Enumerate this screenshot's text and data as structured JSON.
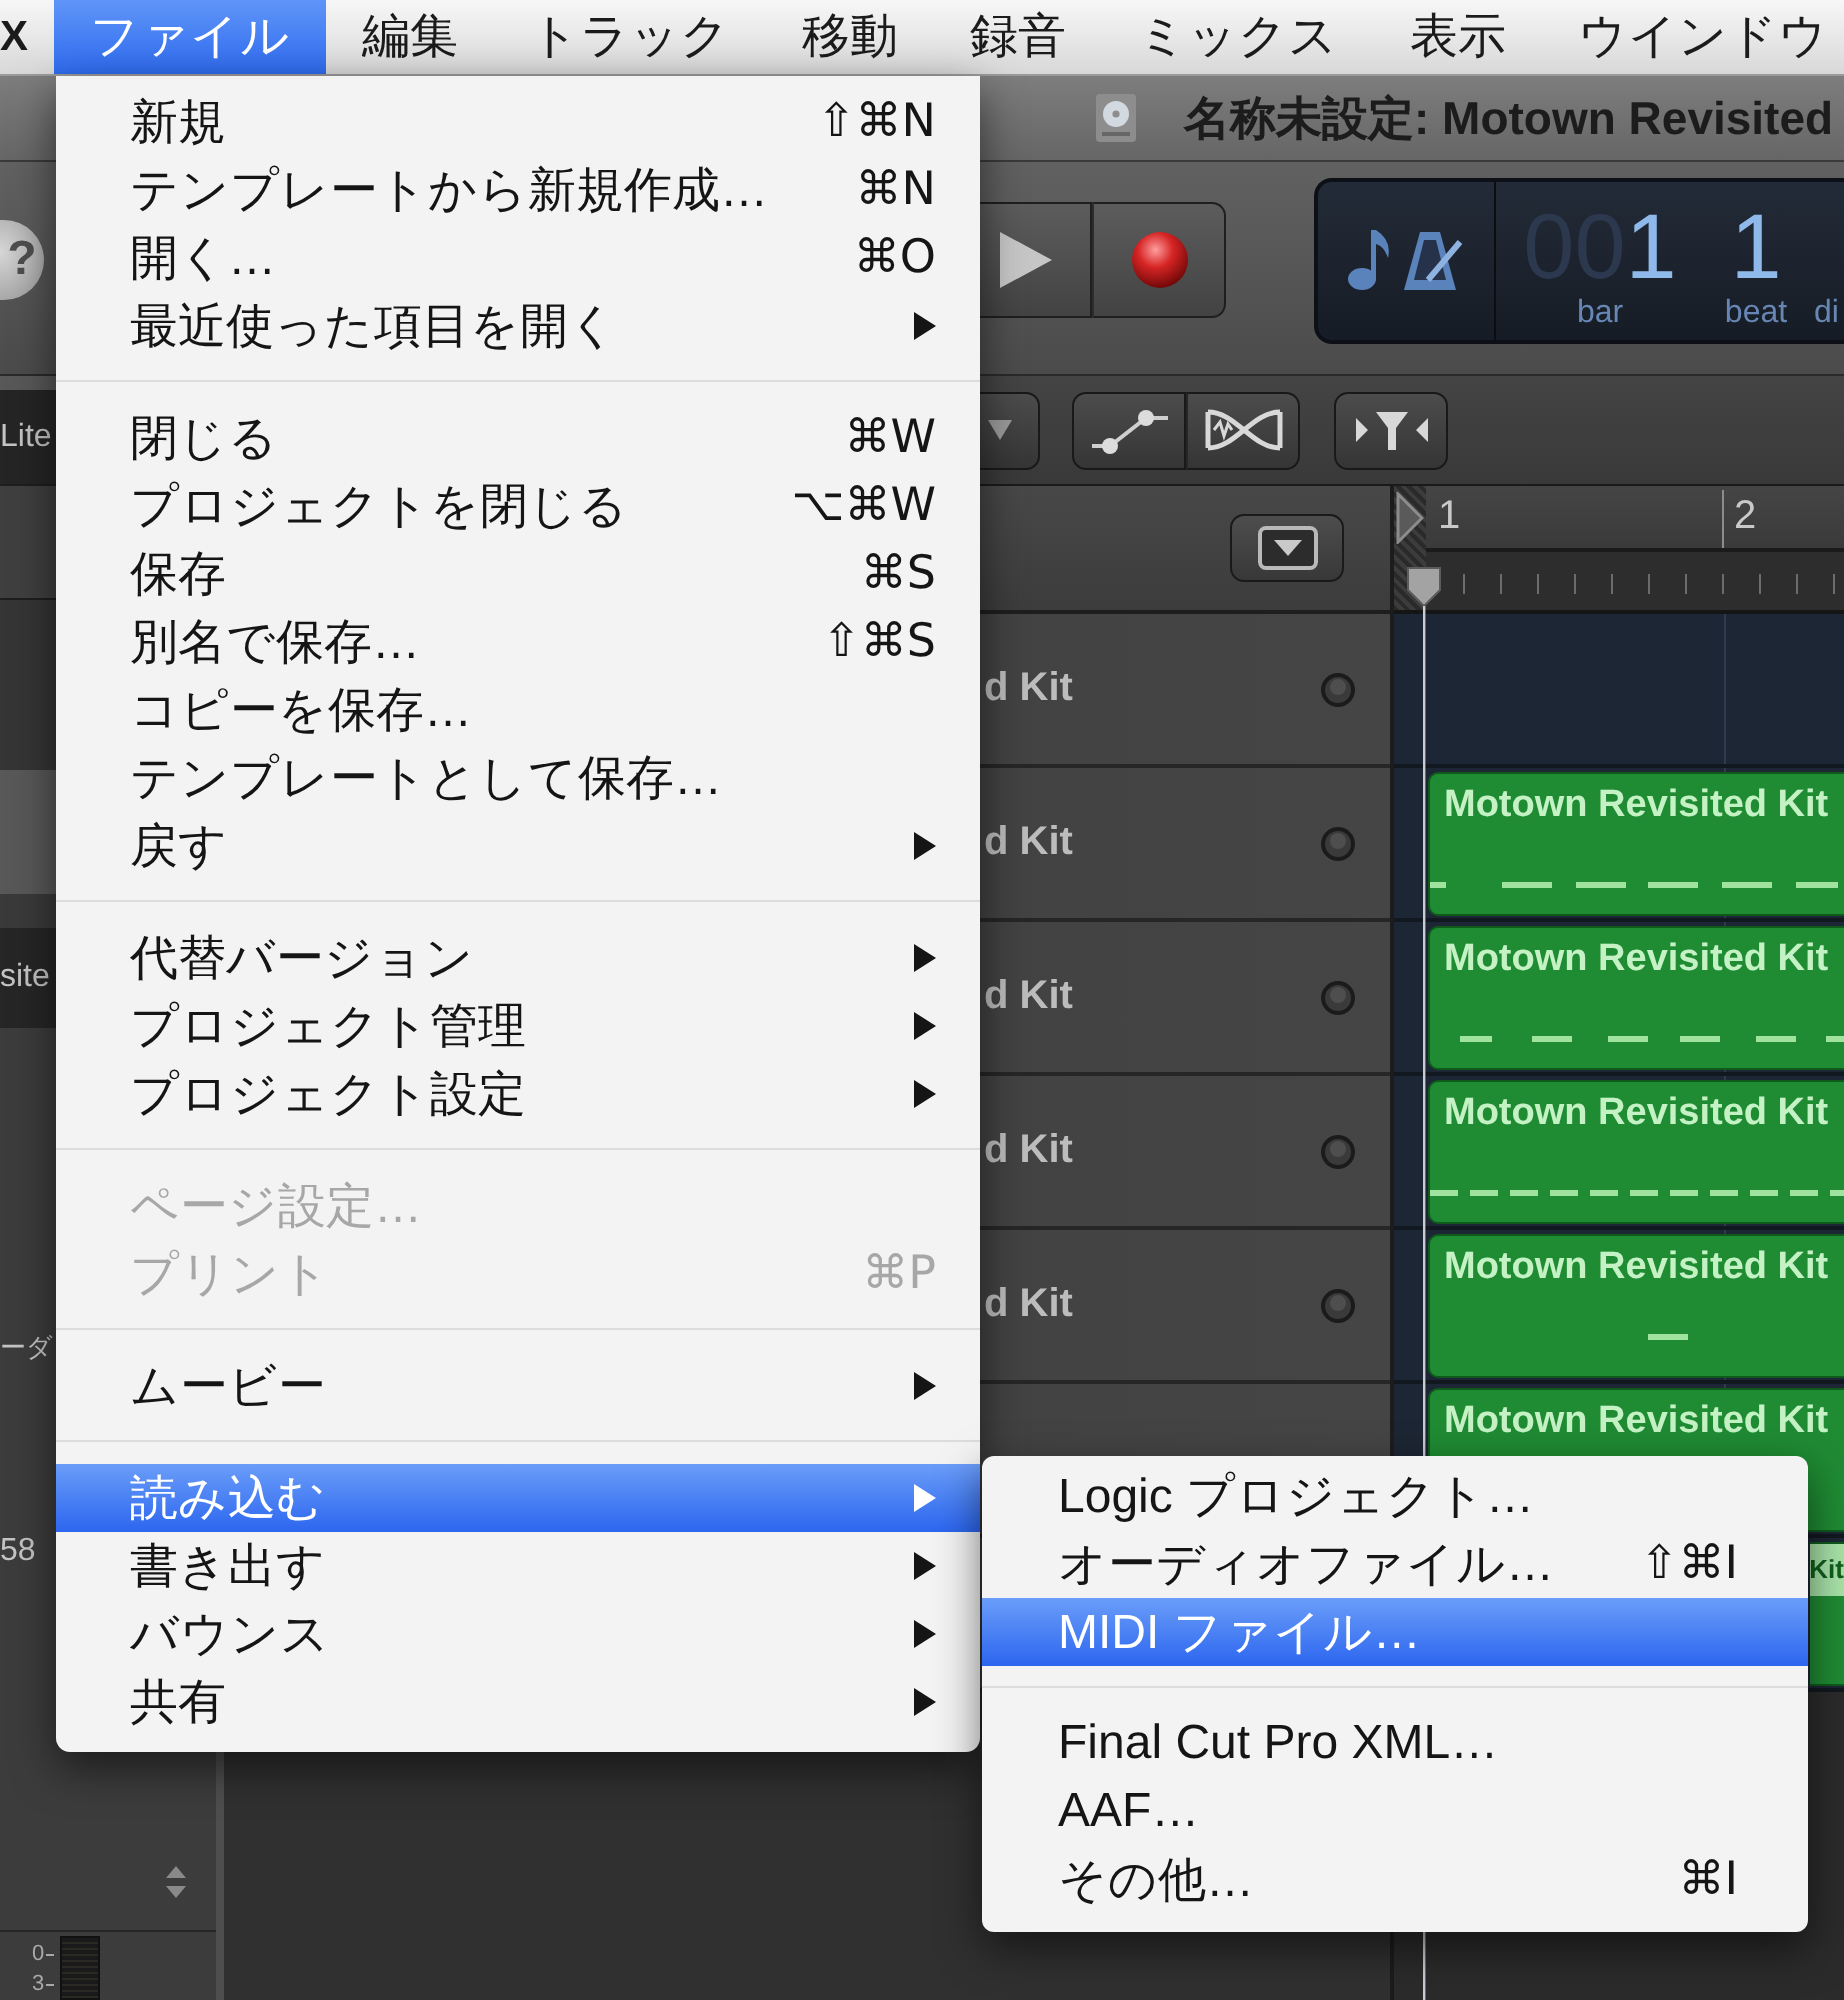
{
  "menu_bar": {
    "app_name": "X",
    "menus": [
      {
        "label": "ファイル",
        "selected": true
      },
      {
        "label": "編集",
        "selected": false
      },
      {
        "label": "トラック",
        "selected": false
      },
      {
        "label": "移動",
        "selected": false
      },
      {
        "label": "録音",
        "selected": false
      },
      {
        "label": "ミックス",
        "selected": false
      },
      {
        "label": "表示",
        "selected": false
      },
      {
        "label": "ウインドウ",
        "selected": false
      }
    ]
  },
  "file_menu": {
    "sections": [
      {
        "items": [
          {
            "label": "新規",
            "shortcut": "⇧⌘N",
            "submenu": false,
            "disabled": false,
            "selected": false
          },
          {
            "label": "テンプレートから新規作成…",
            "shortcut": "⌘N",
            "submenu": false,
            "disabled": false,
            "selected": false
          },
          {
            "label": "開く…",
            "shortcut": "⌘O",
            "submenu": false,
            "disabled": false,
            "selected": false
          },
          {
            "label": "最近使った項目を開く",
            "submenu": true,
            "disabled": false,
            "selected": false
          }
        ]
      },
      {
        "items": [
          {
            "label": "閉じる",
            "shortcut": "⌘W",
            "submenu": false,
            "disabled": false,
            "selected": false
          },
          {
            "label": "プロジェクトを閉じる",
            "shortcut": "⌥⌘W",
            "submenu": false,
            "disabled": false,
            "selected": false
          },
          {
            "label": "保存",
            "shortcut": "⌘S",
            "submenu": false,
            "disabled": false,
            "selected": false
          },
          {
            "label": "別名で保存…",
            "shortcut": "⇧⌘S",
            "submenu": false,
            "disabled": false,
            "selected": false
          },
          {
            "label": "コピーを保存…",
            "submenu": false,
            "disabled": false,
            "selected": false
          },
          {
            "label": "テンプレートとして保存…",
            "submenu": false,
            "disabled": false,
            "selected": false
          },
          {
            "label": "戻す",
            "submenu": true,
            "disabled": false,
            "selected": false
          }
        ]
      },
      {
        "items": [
          {
            "label": "代替バージョン",
            "submenu": true,
            "disabled": false,
            "selected": false
          },
          {
            "label": "プロジェクト管理",
            "submenu": true,
            "disabled": false,
            "selected": false
          },
          {
            "label": "プロジェクト設定",
            "submenu": true,
            "disabled": false,
            "selected": false
          }
        ]
      },
      {
        "items": [
          {
            "label": "ページ設定…",
            "submenu": false,
            "disabled": true,
            "selected": false
          },
          {
            "label": "プリント",
            "shortcut": "⌘P",
            "submenu": false,
            "disabled": true,
            "selected": false
          }
        ]
      },
      {
        "items": [
          {
            "label": "ムービー",
            "submenu": true,
            "disabled": false,
            "selected": false
          }
        ]
      },
      {
        "items": [
          {
            "label": "読み込む",
            "submenu": true,
            "disabled": false,
            "selected": true
          },
          {
            "label": "書き出す",
            "submenu": true,
            "disabled": false,
            "selected": false
          },
          {
            "label": "バウンス",
            "submenu": true,
            "disabled": false,
            "selected": false
          },
          {
            "label": "共有",
            "submenu": true,
            "disabled": false,
            "selected": false
          }
        ]
      }
    ]
  },
  "import_submenu": {
    "sections": [
      {
        "items": [
          {
            "label": "Logic プロジェクト…",
            "submenu": false,
            "disabled": false,
            "selected": false
          },
          {
            "label": "オーディオファイル…",
            "shortcut": "⇧⌘I",
            "submenu": false,
            "disabled": false,
            "selected": false
          },
          {
            "label": "MIDI ファイル…",
            "submenu": false,
            "disabled": false,
            "selected": true
          }
        ]
      },
      {
        "items": [
          {
            "label": "Final Cut Pro XML…",
            "submenu": false,
            "disabled": false,
            "selected": false
          },
          {
            "label": "AAF…",
            "submenu": false,
            "disabled": false,
            "selected": false
          },
          {
            "label": "その他…",
            "shortcut": "⌘I",
            "submenu": false,
            "disabled": false,
            "selected": false
          }
        ]
      }
    ]
  },
  "window": {
    "title": "名称未設定: Motown Revisited"
  },
  "control_bar": {
    "help_label": "?",
    "lcd": {
      "columns": [
        {
          "dim": "00",
          "value": "1",
          "label": "bar"
        },
        {
          "value": "1",
          "label": "beat"
        },
        {
          "label": "di"
        }
      ]
    }
  },
  "inspector": {
    "section_texts": [
      "Lite",
      "site"
    ],
    "side_texts": [
      "ーダ",
      "58"
    ],
    "meter_scale": [
      "0",
      "3"
    ]
  },
  "ruler": {
    "bars": [
      "1",
      "2"
    ]
  },
  "tracks": [
    {
      "name": "d Kit"
    },
    {
      "name": "d Kit",
      "region": {
        "label": "Motown Revisited Kit",
        "kind": "full",
        "selected": false
      }
    },
    {
      "name": "d Kit",
      "region": {
        "label": "Motown Revisited Kit",
        "kind": "full",
        "selected": false
      }
    },
    {
      "name": "d Kit",
      "region": {
        "label": "Motown Revisited Kit",
        "kind": "full",
        "selected": false
      }
    },
    {
      "name": "d Kit",
      "region": {
        "label": "Motown Revisited Kit",
        "kind": "full",
        "selected": false
      }
    },
    {
      "region": {
        "label": "Motown Revisited Kit",
        "kind": "full",
        "selected": false
      }
    },
    {
      "region": {
        "label": "Kit",
        "kind": "partial",
        "selected": true
      }
    }
  ]
}
